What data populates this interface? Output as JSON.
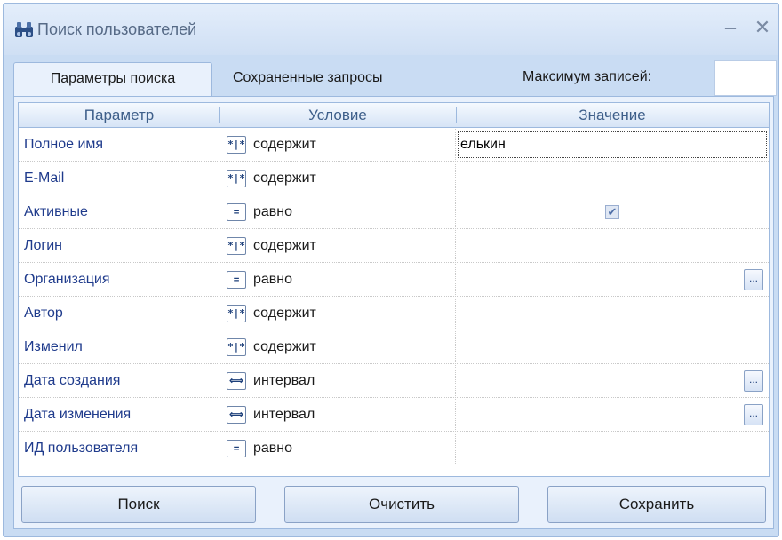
{
  "window": {
    "title": "Поиск пользователей",
    "minimize_glyph": "–",
    "close_glyph": "✕"
  },
  "tabs": [
    {
      "label": "Параметры поиска",
      "active": true
    },
    {
      "label": "Сохраненные запросы",
      "active": false
    }
  ],
  "max_records": {
    "label": "Максимум записей:",
    "value": ""
  },
  "grid": {
    "columns": [
      "Параметр",
      "Условие",
      "Значение"
    ],
    "rows": [
      {
        "param": "Полное имя",
        "op_icon": "contains-icon",
        "op_glyph": "*|*",
        "condition": "содержит",
        "value": "елькин"
      },
      {
        "param": "E-Mail",
        "op_icon": "contains-icon",
        "op_glyph": "*|*",
        "condition": "содержит",
        "value": ""
      },
      {
        "param": "Активные",
        "op_icon": "equals-icon",
        "op_glyph": "=",
        "condition": "равно",
        "value": "",
        "checkbox": true
      },
      {
        "param": "Логин",
        "op_icon": "contains-icon",
        "op_glyph": "*|*",
        "condition": "содержит",
        "value": ""
      },
      {
        "param": "Организация",
        "op_icon": "equals-icon",
        "op_glyph": "=",
        "condition": "равно",
        "value": "",
        "ellipsis": "..."
      },
      {
        "param": "Автор",
        "op_icon": "contains-icon",
        "op_glyph": "*|*",
        "condition": "содержит",
        "value": ""
      },
      {
        "param": "Изменил",
        "op_icon": "contains-icon",
        "op_glyph": "*|*",
        "condition": "содержит",
        "value": ""
      },
      {
        "param": "Дата создания",
        "op_icon": "interval-icon",
        "op_glyph": "⟺",
        "condition": "интервал",
        "value": "",
        "ellipsis": "..."
      },
      {
        "param": "Дата изменения",
        "op_icon": "interval-icon",
        "op_glyph": "⟺",
        "condition": "интервал",
        "value": "",
        "ellipsis": "..."
      },
      {
        "param": "ИД пользователя",
        "op_icon": "equals-icon",
        "op_glyph": "=",
        "condition": "равно",
        "value": ""
      }
    ]
  },
  "buttons": {
    "search": "Поиск",
    "clear": "Очистить",
    "save": "Сохранить"
  },
  "check_glyph": "✔"
}
